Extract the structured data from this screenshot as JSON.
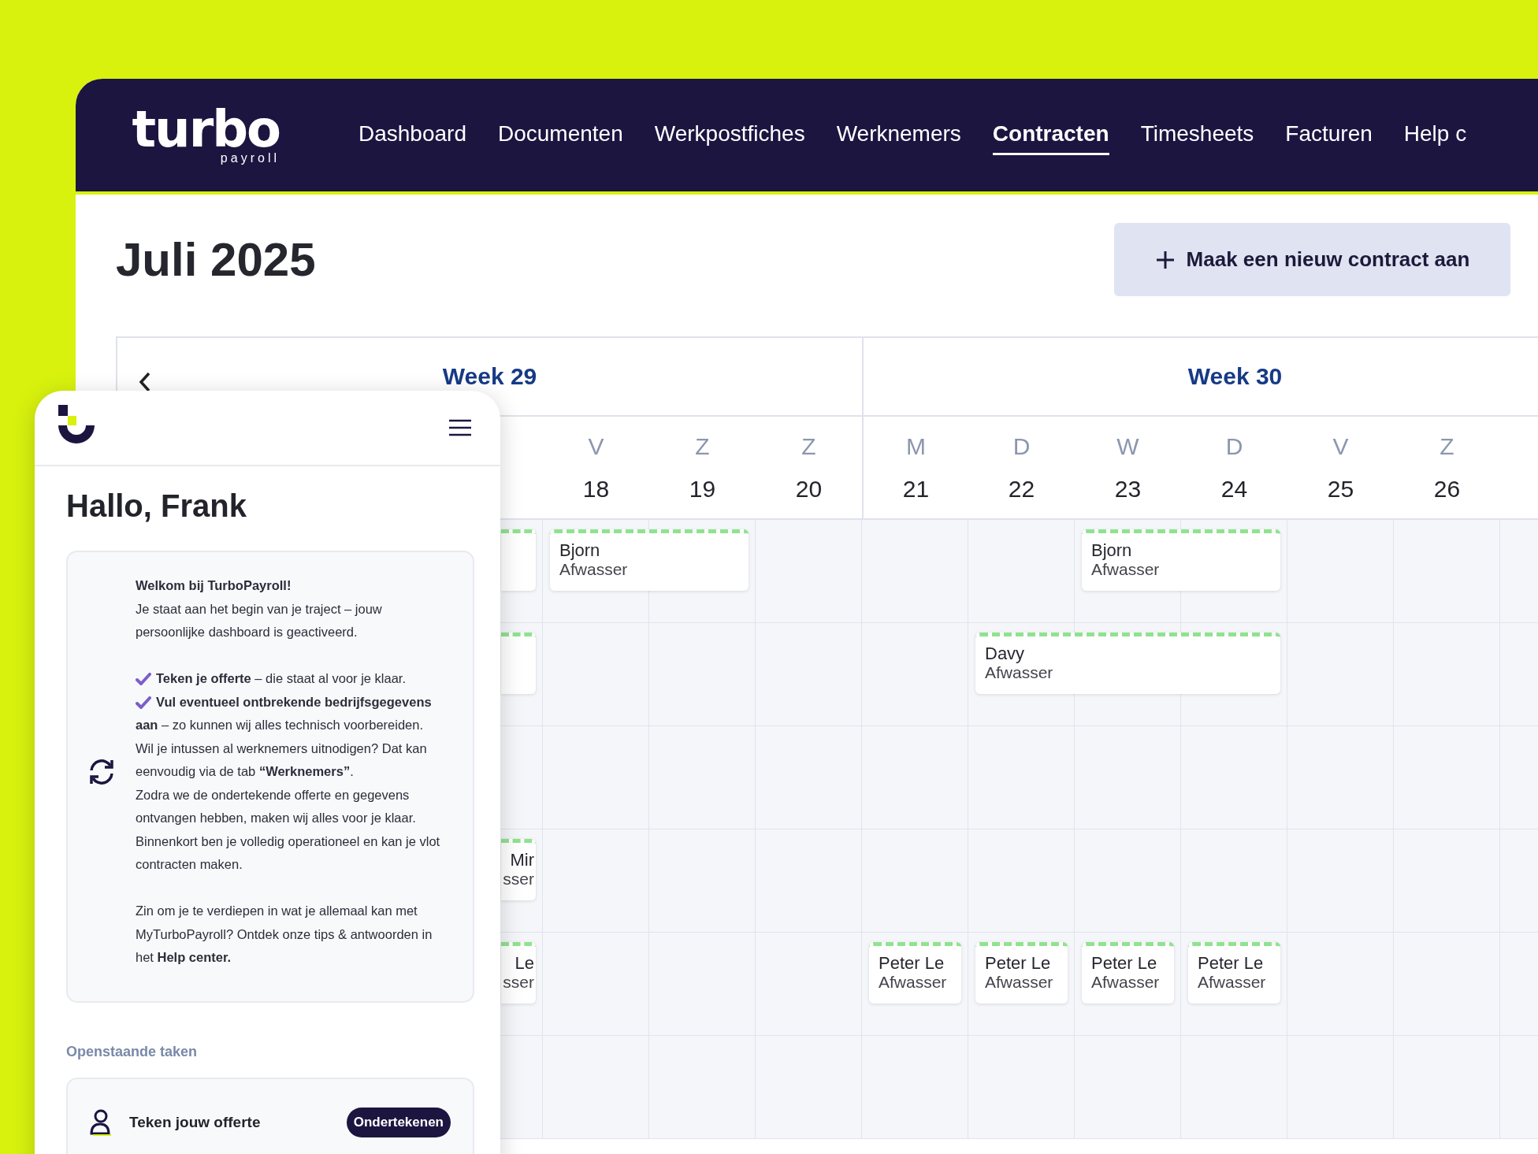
{
  "logo": {
    "wordmark": "turbo",
    "tagline": "payroll"
  },
  "nav": [
    {
      "label": "Dashboard",
      "selected": false
    },
    {
      "label": "Documenten",
      "selected": false
    },
    {
      "label": "Werkpostfiches",
      "selected": false
    },
    {
      "label": "Werknemers",
      "selected": false
    },
    {
      "label": "Contracten",
      "selected": true
    },
    {
      "label": "Timesheets",
      "selected": false
    },
    {
      "label": "Facturen",
      "selected": false
    },
    {
      "label": "Help c",
      "selected": false
    }
  ],
  "title": "Juli 2025",
  "new_button": "Maak een nieuw contract aan",
  "weeks": [
    {
      "label": "Week 29",
      "days": [
        {
          "letter": "V",
          "number": "18"
        },
        {
          "letter": "Z",
          "number": "19"
        },
        {
          "letter": "Z",
          "number": "20"
        }
      ]
    },
    {
      "label": "Week 30",
      "days": [
        {
          "letter": "M",
          "number": "21"
        },
        {
          "letter": "D",
          "number": "22"
        },
        {
          "letter": "W",
          "number": "23"
        },
        {
          "letter": "D",
          "number": "24"
        },
        {
          "letter": "V",
          "number": "25"
        },
        {
          "letter": "Z",
          "number": "26"
        }
      ]
    }
  ],
  "rows": [
    {
      "cells": [
        {
          "kind": "empty"
        },
        {
          "kind": "empty"
        },
        {
          "kind": "empty"
        },
        {
          "kind": "partial"
        },
        {
          "kind": "event",
          "name": "Bjorn",
          "role": "Afwasser"
        },
        {
          "kind": "cont"
        },
        {
          "kind": "empty"
        },
        {
          "kind": "empty"
        },
        {
          "kind": "empty"
        },
        {
          "kind": "event",
          "name": "Bjorn",
          "role": "Afwasser"
        },
        {
          "kind": "cont"
        }
      ]
    },
    {
      "cells": [
        {
          "kind": "empty"
        },
        {
          "kind": "empty"
        },
        {
          "kind": "empty"
        },
        {
          "kind": "partial"
        },
        {
          "kind": "empty"
        },
        {
          "kind": "empty"
        },
        {
          "kind": "empty"
        },
        {
          "kind": "empty"
        },
        {
          "kind": "event",
          "name": "Davy",
          "role": "Afwasser"
        },
        {
          "kind": "cont"
        },
        {
          "kind": "cont"
        }
      ]
    },
    {
      "cells": []
    },
    {
      "cells": [
        {
          "kind": "empty"
        },
        {
          "kind": "empty"
        },
        {
          "kind": "empty"
        },
        {
          "kind": "partial",
          "name": "Mir",
          "role": "sser"
        }
      ]
    },
    {
      "cells": [
        {
          "kind": "empty"
        },
        {
          "kind": "empty"
        },
        {
          "kind": "empty"
        },
        {
          "kind": "partial",
          "name": "Le",
          "role": "sser"
        },
        {
          "kind": "empty"
        },
        {
          "kind": "empty"
        },
        {
          "kind": "empty"
        },
        {
          "kind": "event",
          "name": "Peter Le",
          "role": "Afwasser"
        },
        {
          "kind": "event",
          "name": "Peter Le",
          "role": "Afwasser"
        },
        {
          "kind": "event",
          "name": "Peter Le",
          "role": "Afwasser"
        },
        {
          "kind": "event",
          "name": "Peter Le",
          "role": "Afwasser"
        }
      ]
    },
    {
      "cells": []
    }
  ],
  "phone": {
    "greeting": "Hallo, Frank",
    "welcome": {
      "title": "Welkom bij TurboPayroll!",
      "intro": "Je staat aan het begin van je traject – jouw persoonlijke dashboard is geactiveerd.",
      "checklist": [
        {
          "text": "**Teken je offerte** – die staat al voor je klaar.",
          "checked": true
        },
        {
          "text": "**Vul eventueel ontbrekende bedrijfsgegevens aan** – zo kunnen wij alles technisch voorbereiden.",
          "checked": true
        }
      ],
      "paragraphs": [
        "Wil je intussen al werknemers uitnodigen? Dat kan eenvoudig via de tab **“Werknemers”**.",
        "Zodra we de ondertekende offerte en gegevens ontvangen hebben, maken wij alles voor je klaar. Binnenkort ben je volledig operationeel en kan je vlot contracten maken."
      ],
      "help": "Zin om je te verdiepen in wat je allemaal kan met MyTurboPayroll? Ontdek onze tips & antwoorden in het **Help center.**"
    },
    "tasks_title": "Openstaande taken",
    "tasks": [
      {
        "label": "Teken jouw offerte",
        "action": "Ondertekenen"
      }
    ]
  }
}
